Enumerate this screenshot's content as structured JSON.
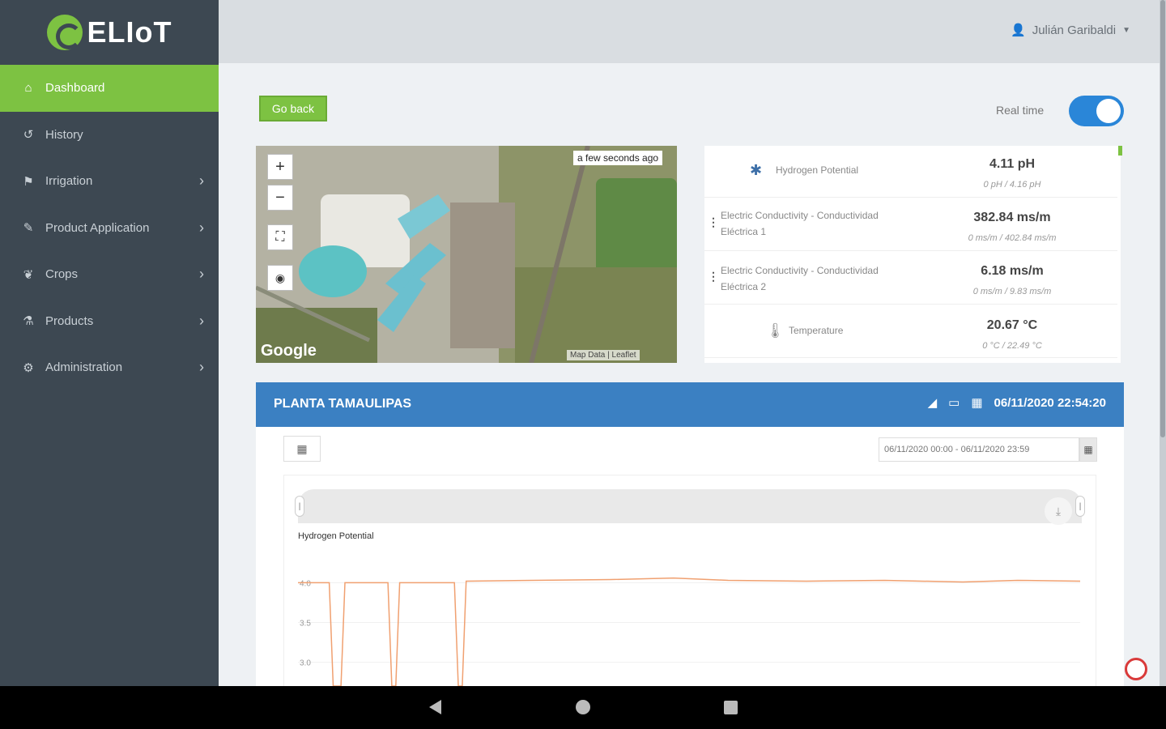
{
  "app": {
    "logo_text": "ELIoT"
  },
  "user": {
    "name": "Julián Garibaldi"
  },
  "sidebar": {
    "items": [
      {
        "label": "Dashboard",
        "icon": "home-icon",
        "glyph": "⌂"
      },
      {
        "label": "History",
        "icon": "history-icon",
        "glyph": "↺"
      },
      {
        "label": "Irrigation",
        "icon": "flag-icon",
        "glyph": "⚑"
      },
      {
        "label": "Product Application",
        "icon": "spray-icon",
        "glyph": "✎"
      },
      {
        "label": "Crops",
        "icon": "leaf-icon",
        "glyph": "❦"
      },
      {
        "label": "Products",
        "icon": "flask-icon",
        "glyph": "⚗"
      },
      {
        "label": "Administration",
        "icon": "gear-icon",
        "glyph": "⚙"
      }
    ]
  },
  "toolbar": {
    "go_back": "Go back",
    "realtime_label": "Real time",
    "realtime_on": true
  },
  "map": {
    "zoom_in": "+",
    "zoom_out": "−",
    "fullscreen": "⛶",
    "locate": "◉",
    "timestamp": "a few seconds ago",
    "provider": "Google",
    "credit": "Map Data | Leaflet"
  },
  "sensors": [
    {
      "name": "Hydrogen Potential",
      "value": "4.11 pH",
      "range": "0 pH / 4.16 pH",
      "icon": "snowflake-icon"
    },
    {
      "name": "Electric Conductivity - Conductividad Eléctrica 1",
      "value": "382.84 ms/m",
      "range": "0 ms/m / 402.84 ms/m",
      "icon": "kebab-icon"
    },
    {
      "name": "Electric Conductivity - Conductividad Eléctrica 2",
      "value": "6.18 ms/m",
      "range": "0 ms/m / 9.83 ms/m",
      "icon": "kebab-icon"
    },
    {
      "name": "Temperature",
      "value": "20.67 °C",
      "range": "0 °C / 22.49 °C",
      "icon": "thermometer-icon"
    }
  ],
  "panel": {
    "title": "PLANTA TAMAULIPAS",
    "timestamp": "06/11/2020 22:54:20",
    "date_range": "06/11/2020 00:00 - 06/11/2020 23:59",
    "series_label": "Hydrogen Potential"
  },
  "chart_data": {
    "type": "line",
    "series": [
      {
        "name": "Hydrogen Potential",
        "color": "#f0a070",
        "points": [
          [
            0.0,
            4.0
          ],
          [
            0.04,
            4.0
          ],
          [
            0.045,
            0
          ],
          [
            0.055,
            0
          ],
          [
            0.06,
            4.0
          ],
          [
            0.115,
            4.0
          ],
          [
            0.12,
            0
          ],
          [
            0.125,
            0
          ],
          [
            0.13,
            4.0
          ],
          [
            0.2,
            4.0
          ],
          [
            0.205,
            0
          ],
          [
            0.21,
            0
          ],
          [
            0.215,
            4.02
          ],
          [
            0.3,
            4.03
          ],
          [
            0.4,
            4.04
          ],
          [
            0.48,
            4.06
          ],
          [
            0.55,
            4.03
          ],
          [
            0.65,
            4.02
          ],
          [
            0.75,
            4.03
          ],
          [
            0.85,
            4.01
          ],
          [
            0.92,
            4.03
          ],
          [
            1.0,
            4.02
          ]
        ]
      }
    ],
    "yticks": [
      "4.0",
      "3.5",
      "3.0"
    ],
    "ylim": [
      2.7,
      4.3
    ]
  }
}
